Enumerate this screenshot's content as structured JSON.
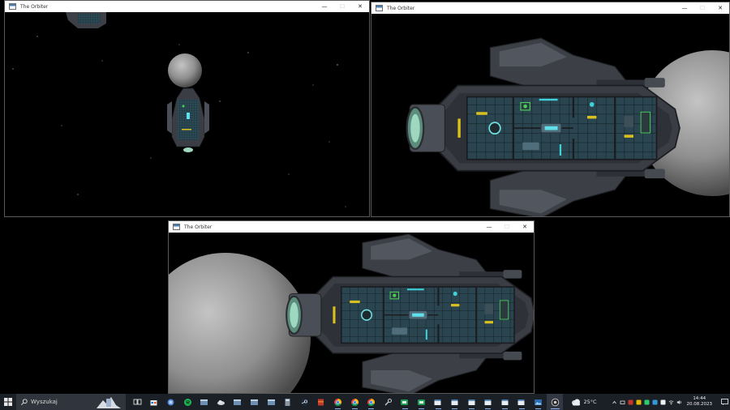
{
  "windows": [
    {
      "id": "top-left",
      "title": "The Orbiter",
      "controls": [
        "—",
        "☐",
        "✕"
      ]
    },
    {
      "id": "top-right",
      "title": "The Orbiter",
      "controls": [
        "—",
        "☐",
        "✕"
      ]
    },
    {
      "id": "bottom",
      "title": "The Orbiter",
      "controls": [
        "—",
        "☐",
        "✕"
      ]
    }
  ],
  "taskbar": {
    "start_icon": "windows-logo-icon",
    "search_placeholder": "Wyszukaj",
    "apps": [
      {
        "icon": "task-view-icon",
        "state": "none"
      },
      {
        "icon": "store-icon",
        "state": "none"
      },
      {
        "icon": "app-blue-icon",
        "state": "none"
      },
      {
        "icon": "spotify-icon",
        "state": "none"
      },
      {
        "icon": "app-window-icon",
        "state": "none"
      },
      {
        "icon": "cloud-app-icon",
        "state": "none"
      },
      {
        "icon": "app-window-icon",
        "state": "none"
      },
      {
        "icon": "app-window-icon",
        "state": "none"
      },
      {
        "icon": "app-window-icon",
        "state": "none"
      },
      {
        "icon": "calculator-icon",
        "state": "none"
      },
      {
        "icon": "steam-icon",
        "state": "none"
      },
      {
        "icon": "archive-icon",
        "state": "none"
      },
      {
        "icon": "chrome-icon",
        "state": "open"
      },
      {
        "icon": "chrome-icon",
        "state": "open"
      },
      {
        "icon": "chrome-icon",
        "state": "open"
      },
      {
        "icon": "tool-icon",
        "state": "none"
      },
      {
        "icon": "green-app-icon",
        "state": "open"
      },
      {
        "icon": "green-app-icon",
        "state": "open"
      },
      {
        "icon": "window-app-icon",
        "state": "open"
      },
      {
        "icon": "window-app-icon",
        "state": "open"
      },
      {
        "icon": "window-app-icon",
        "state": "open"
      },
      {
        "icon": "window-app-icon",
        "state": "open"
      },
      {
        "icon": "window-app-icon",
        "state": "open"
      },
      {
        "icon": "window-app-icon",
        "state": "open"
      },
      {
        "icon": "image-app-icon",
        "state": "open"
      },
      {
        "icon": "orbiter-app-icon",
        "state": "active"
      }
    ],
    "weather": {
      "icon": "weather-cloudy-icon",
      "temperature": "25°C"
    },
    "tray_icons": [
      "chevron-up-icon",
      "network-icon",
      "app-tray-icon",
      "app-tray-icon",
      "app-tray-icon",
      "app-tray-icon",
      "app-tray-icon",
      "wifi-icon",
      "speaker-icon"
    ],
    "clock": {
      "time": "14:44",
      "date": "20.08.2023"
    },
    "notification_icon": "notification-icon"
  },
  "colors": {
    "titlebar": "#ffffff",
    "taskbar": "#1b1f26",
    "space": "#000000",
    "hull": "#3a3d44",
    "floor": "#2a4a55",
    "moon": "#9a9a9a",
    "accent_cyan": "#3fd0d8",
    "accent_green": "#4ad05a",
    "accent_yellow": "#d8c020"
  }
}
